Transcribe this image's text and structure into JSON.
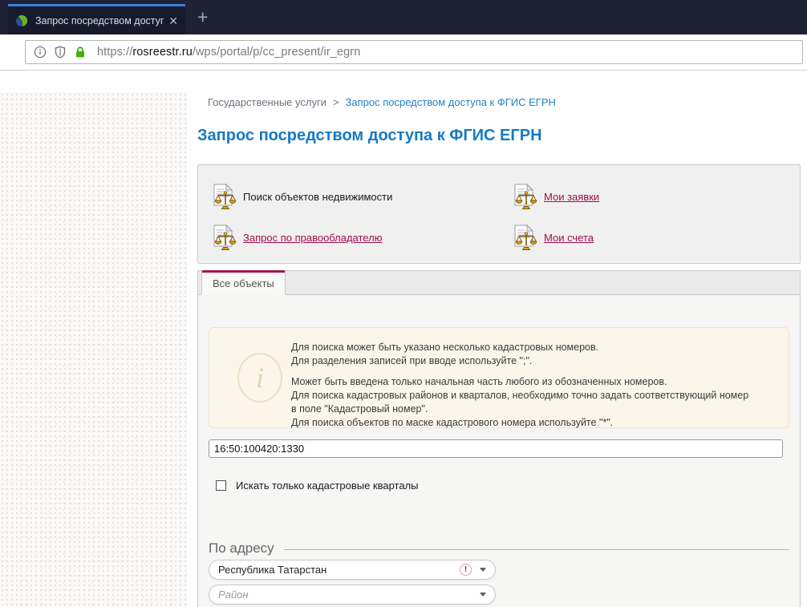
{
  "browser": {
    "tab": {
      "title": "Запрос посредством доступа",
      "close_glyph": "✕",
      "new_tab_glyph": "+"
    },
    "url": {
      "scheme": "https://",
      "host": "rosreestr.ru",
      "path": "/wps/portal/p/cc_present/ir_egrn"
    }
  },
  "page": {
    "breadcrumb": {
      "parent": "Государственные услуги",
      "separator": ">",
      "current": "Запрос посредством доступа к ФГИС ЕГРН"
    },
    "title": "Запрос посредством доступа к ФГИС ЕГРН",
    "quick_links": {
      "search_objects": "Поиск объектов недвижимости",
      "my_requests": "Мои заявки",
      "request_by_rightholder": "Запрос по правообладателю",
      "my_accounts": "Мои счета"
    },
    "tabs": {
      "all_objects": "Все объекты"
    },
    "info_box": {
      "icon_glyph": "i",
      "para1": {
        "l1": "Для поиска может быть указано несколько кадастровых номеров.",
        "l2": "Для разделения записей при вводе используйте \";\"."
      },
      "para2": {
        "l1": "Может быть введена только начальная часть любого из обозначенных номеров.",
        "l2": "Для поиска кадастровых районов и кварталов, необходимо точно задать соответствующий номер",
        "l3": "в поле \"Кадастровый номер\".",
        "l4": "Для поиска объектов по маске кадастрового номера используйте \"*\"."
      }
    },
    "cadastral_input": {
      "value": "16:50:100420:1330"
    },
    "quarters_checkbox": {
      "label": "Искать только кадастровые кварталы",
      "checked": false
    },
    "address_section": {
      "legend": "По адресу",
      "region_dropdown": {
        "value": "Республика Татарстан",
        "warning_glyph": "!"
      },
      "district_dropdown": {
        "placeholder": "Район"
      }
    }
  },
  "colors": {
    "tabbar_bg": "#1f2235",
    "active_tab_stripe": "#3c7ee0",
    "title_blue": "#167ac1",
    "link_crimson": "#a00d4b",
    "tab_accent_crimson": "#a81440",
    "infobox_bg": "#fcf5e9",
    "lock_green": "#43b309"
  }
}
